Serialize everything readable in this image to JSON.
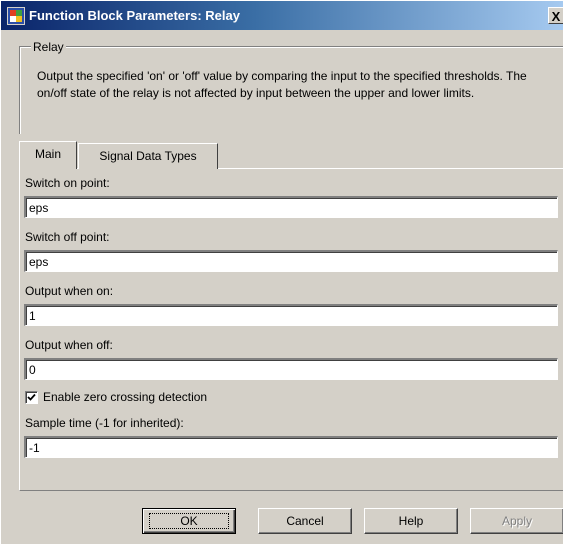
{
  "window": {
    "title": "Function Block Parameters: Relay",
    "close_label": "X"
  },
  "group": {
    "legend": "Relay",
    "description": "Output the specified 'on' or 'off' value by comparing the input to the specified thresholds.  The on/off state of the relay is not affected by input between the upper and lower limits."
  },
  "tabs": [
    {
      "label": "Main",
      "selected": true
    },
    {
      "label": "Signal Data Types",
      "selected": false
    }
  ],
  "fields": {
    "switch_on": {
      "label": "Switch on point:",
      "value": "eps"
    },
    "switch_off": {
      "label": "Switch off point:",
      "value": "eps"
    },
    "output_on": {
      "label": "Output when on:",
      "value": "1"
    },
    "output_off": {
      "label": "Output when off:",
      "value": "0"
    },
    "sample_time": {
      "label": "Sample time (-1 for inherited):",
      "value": "-1"
    }
  },
  "zero_crossing": {
    "label": "Enable zero crossing detection",
    "checked": true
  },
  "buttons": {
    "ok": "OK",
    "cancel": "Cancel",
    "help": "Help",
    "apply": "Apply"
  }
}
